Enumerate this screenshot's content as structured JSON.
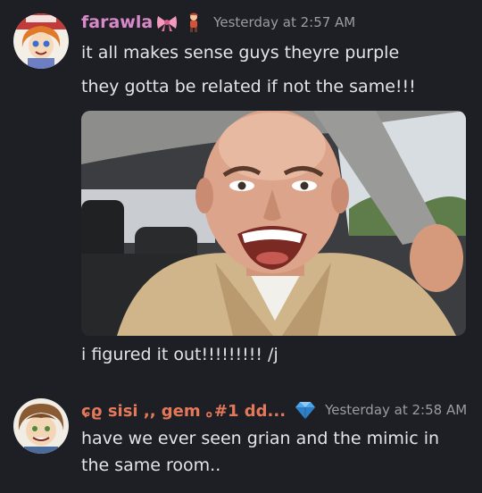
{
  "messages": [
    {
      "author": "farawla",
      "author_color": "#d988c9",
      "badges": [
        "bow-icon",
        "figure-icon"
      ],
      "timestamp": "Yesterday at 2:57 AM",
      "lines": [
        "it all makes sense guys theyre purple",
        "they gotta be related if not the same!!!"
      ],
      "attachment": "image-attachment",
      "followup": "i figured it out!!!!!!!!! /j"
    },
    {
      "author": "ɕϱ sisi ,, gem ｡#1 dd...",
      "author_color": "#e4785a",
      "badges": [
        "diamond-icon"
      ],
      "timestamp": "Yesterday at 2:58 AM",
      "lines": [
        "have we ever seen grian and the mimic in",
        "the same room.."
      ]
    }
  ]
}
